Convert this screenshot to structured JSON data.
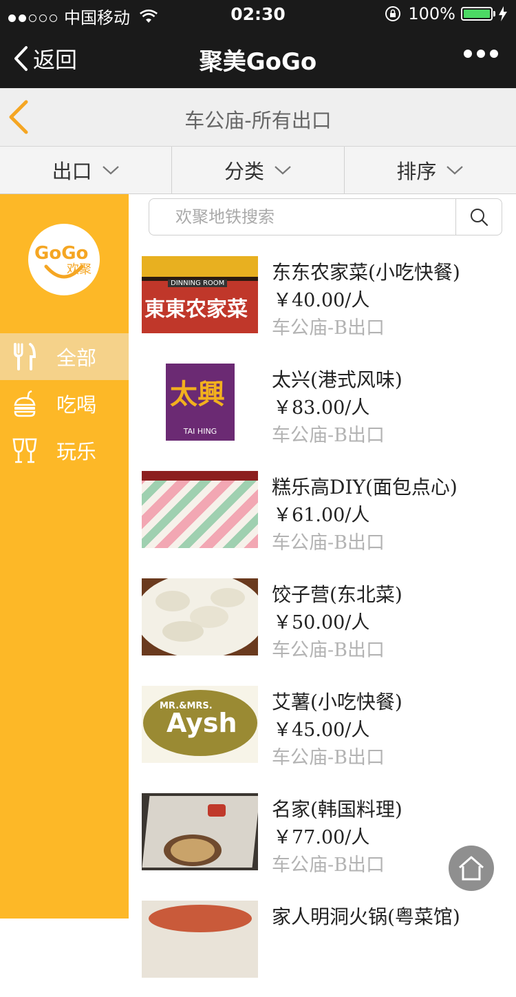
{
  "status_bar": {
    "carrier": "中国移动",
    "time": "02:30",
    "battery_text": "100%",
    "battery_level": 1.0,
    "signal_dots": [
      true,
      true,
      false,
      false,
      false
    ]
  },
  "nav": {
    "back_label": "返回",
    "title": "聚美GoGo"
  },
  "sub_header": {
    "title": "车公庙-所有出口"
  },
  "filters": [
    {
      "label": "出口"
    },
    {
      "label": "分类"
    },
    {
      "label": "排序"
    }
  ],
  "sidebar": {
    "logo": {
      "text_go": "GoGo",
      "text_cn": "欢聚"
    },
    "items": [
      {
        "label": "全部",
        "icon": "fork-knife-icon",
        "active": true
      },
      {
        "label": "吃喝",
        "icon": "burger-icon",
        "active": false
      },
      {
        "label": "玩乐",
        "icon": "glass-icon",
        "active": false
      }
    ]
  },
  "search": {
    "placeholder": "欢聚地铁搜索",
    "value": ""
  },
  "listings": [
    {
      "name": "东东农家菜(小吃快餐)",
      "price": "￥40.00/人",
      "location": "车公庙-B出口",
      "thumb_text": "東東农家菜",
      "thumb_sub": "DINNING ROOM"
    },
    {
      "name": "太兴(港式风味)",
      "price": "￥83.00/人",
      "location": "车公庙-B出口",
      "thumb_text": "太興",
      "thumb_sub": "TAI HING"
    },
    {
      "name": "糕乐高DIY(面包点心)",
      "price": "￥61.00/人",
      "location": "车公庙-B出口"
    },
    {
      "name": "饺子营(东北菜)",
      "price": "￥50.00/人",
      "location": "车公庙-B出口"
    },
    {
      "name": "艾薯(小吃快餐)",
      "price": "￥45.00/人",
      "location": "车公庙-B出口",
      "thumb_text": "Aysh",
      "thumb_sub": "MR.&MRS."
    },
    {
      "name": "名家(韩国料理)",
      "price": "￥77.00/人",
      "location": "车公庙-B出口"
    },
    {
      "name": "家人明洞火锅(粤菜馆)",
      "price": "",
      "location": ""
    }
  ],
  "colors": {
    "accent": "#fdb827",
    "sidebar_active": "#f5d28a",
    "dark_bar": "#1a1a1a",
    "muted_text": "#b3b3b3"
  }
}
